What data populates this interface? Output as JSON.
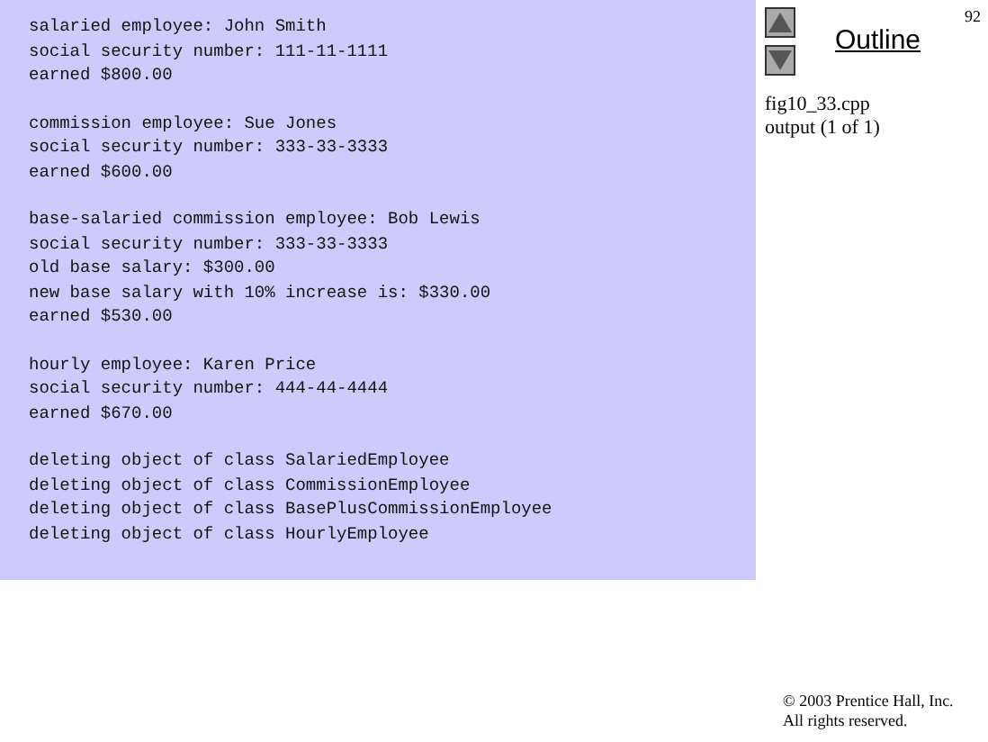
{
  "output": {
    "groups": [
      [
        "salaried employee: John Smith",
        "social security number: 111-11-1111",
        "earned $800.00"
      ],
      [
        "commission employee: Sue Jones",
        "social security number: 333-33-3333",
        "earned $600.00"
      ],
      [
        "base-salaried commission employee: Bob Lewis",
        "social security number: 333-33-3333",
        "old base salary: $300.00",
        "new base salary with 10% increase is: $330.00",
        "earned $530.00"
      ],
      [
        "hourly employee: Karen Price",
        "social security number: 444-44-4444",
        "earned $670.00"
      ],
      [
        "deleting object of class SalariedEmployee",
        "deleting object of class CommissionEmployee",
        "deleting object of class BasePlusCommissionEmployee",
        "deleting object of class HourlyEmployee"
      ]
    ]
  },
  "sidebar": {
    "page_number": "92",
    "title": "Outline",
    "file": "fig10_33.cpp",
    "caption": "output (1 of 1)"
  },
  "footer": {
    "copyright": "© 2003 Prentice Hall, Inc.",
    "rights": "All rights reserved."
  }
}
